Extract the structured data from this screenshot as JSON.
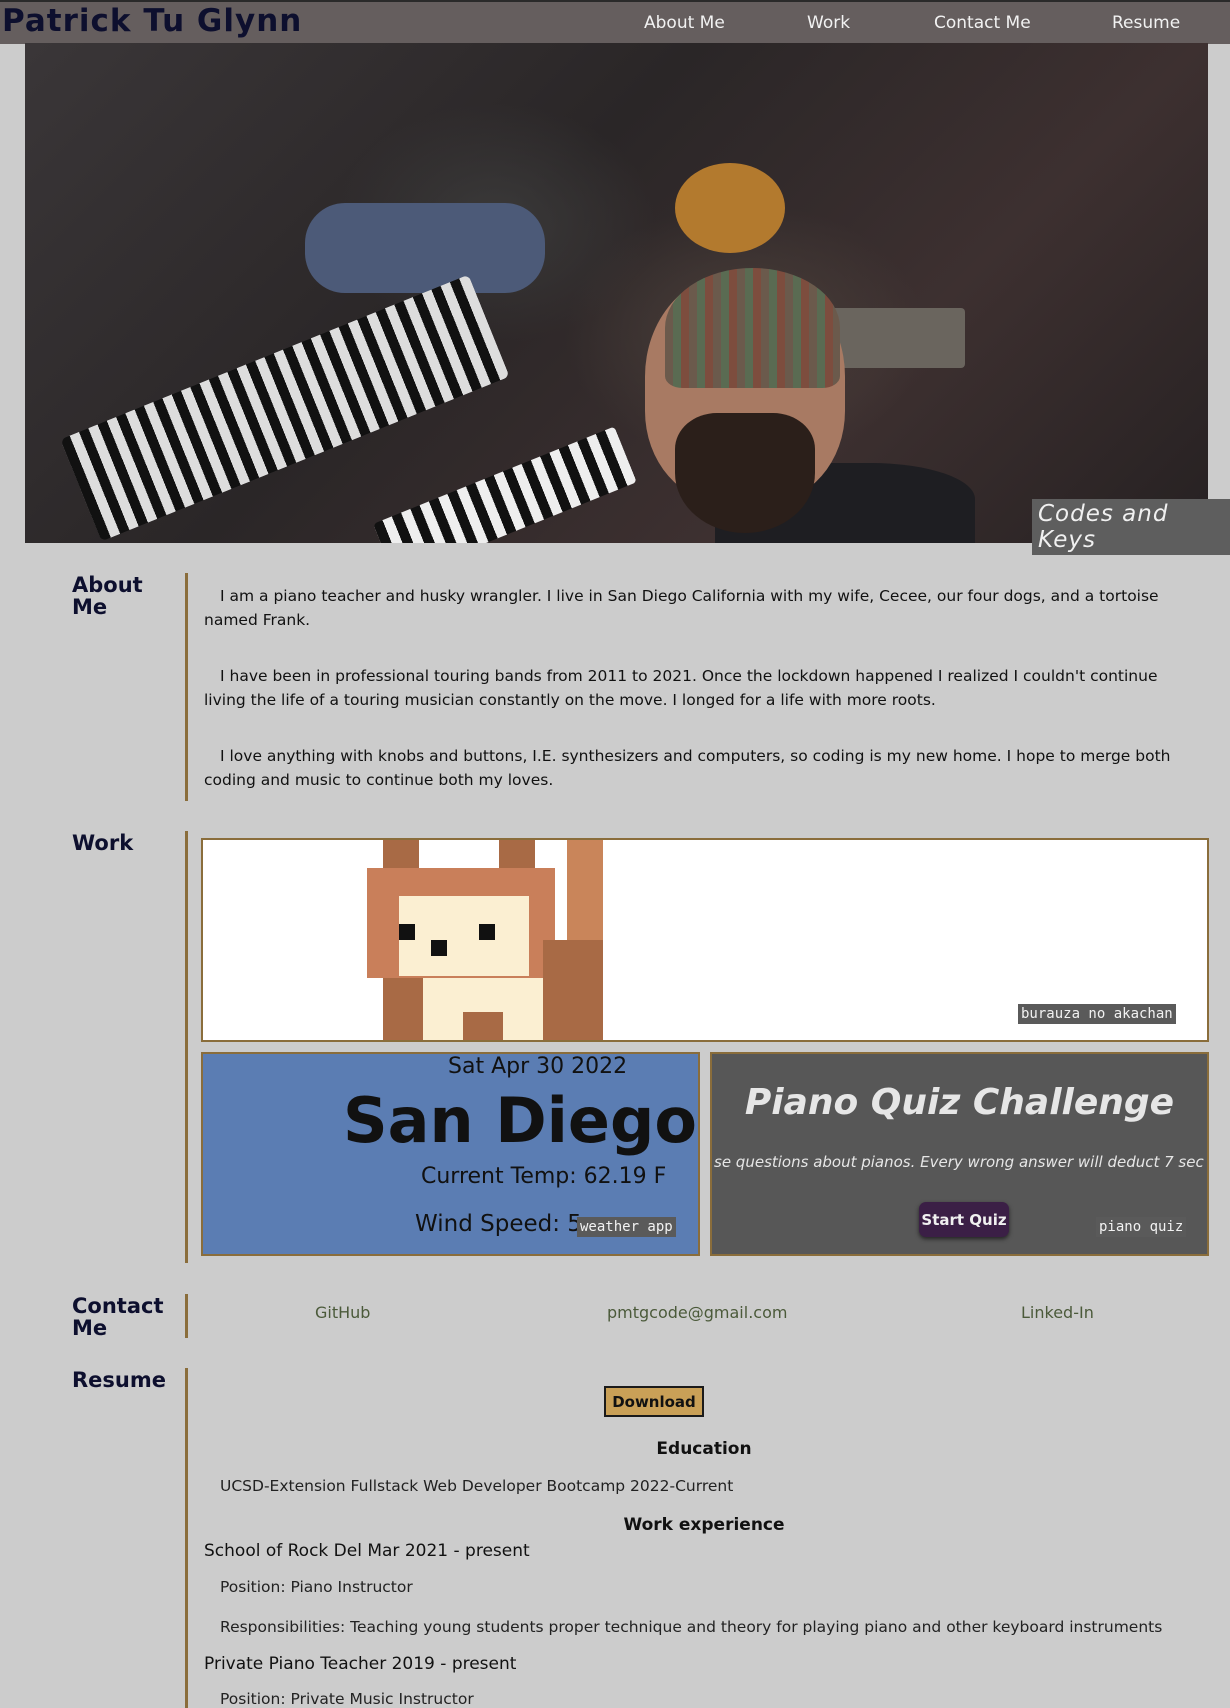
{
  "header": {
    "brand": "Patrick Tu Glynn",
    "nav": [
      "About Me",
      "Work",
      "Contact Me",
      "Resume"
    ]
  },
  "hero": {
    "image_alt": "musician with beanie at keyboards in a studio",
    "tagline": "Codes and Keys"
  },
  "about": {
    "title": "About Me",
    "paragraphs": [
      "I am a piano teacher and husky wrangler. I live in San Diego California with my wife, Cecee, our four dogs, and a tortoise named Frank.",
      "I have been in professional touring bands from 2011 to 2021. Once the lockdown happened I realized I couldn't continue living the life of a touring musician constantly on the move. I longed for a life with more roots.",
      "I love anything with knobs and buttons, I.E. synthesizers and computers, so coding is my new home. I hope to merge both coding and music to continue both my loves."
    ]
  },
  "work": {
    "title": "Work",
    "projects": [
      {
        "label": "burauza no akachan"
      },
      {
        "label": "weather app",
        "date": "Sat Apr 30 2022",
        "city": "San Diego",
        "temp": "Current Temp: 62.19 F",
        "wind": "Wind Speed: 5"
      },
      {
        "label": "piano quiz",
        "title": "Piano Quiz Challenge",
        "desc": "se questions about pianos. Every wrong answer will deduct 7 sec",
        "button": "Start Quiz"
      }
    ]
  },
  "contact": {
    "title": "Contact Me",
    "links": [
      "GitHub",
      "pmtgcode@gmail.com",
      "Linked-In"
    ]
  },
  "resume": {
    "title": "Resume",
    "download": "Download",
    "education_heading": "Education",
    "education": "UCSD-Extension Fullstack Web Developer Bootcamp 2022-Current",
    "work_heading": "Work experience",
    "jobs": [
      {
        "title": "School of Rock Del Mar 2021 - present",
        "position": "Position: Piano Instructor",
        "responsibilities": "Responsibilities: Teaching young students proper technique and theory for playing piano and other keyboard instruments"
      },
      {
        "title": "Private Piano Teacher 2019 - present",
        "position": "Position: Private Music Instructor"
      }
    ]
  },
  "colors": {
    "header_bg": "#655e5e",
    "brand": "#0d0f2e",
    "accent_line": "#8a6d3b",
    "page_bg": "#cccccc",
    "download_btn": "#c9a057"
  }
}
